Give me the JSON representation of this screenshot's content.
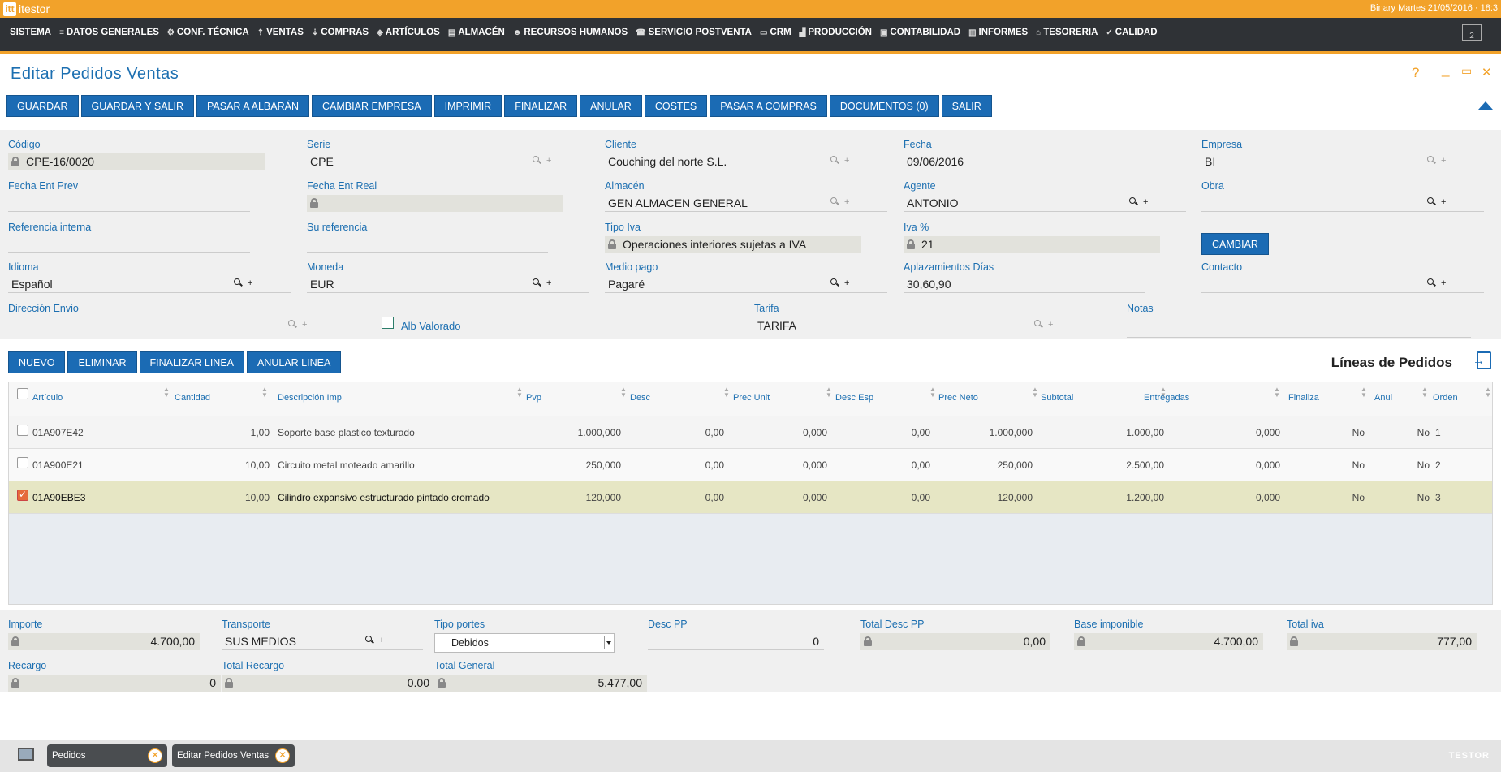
{
  "app": {
    "logo_letters": "itt",
    "name": "itestor",
    "status": "Binary  Martes 21/05/2016 · 18:3"
  },
  "menu": [
    {
      "label": "SISTEMA",
      "icon": ""
    },
    {
      "label": "DATOS GENERALES",
      "icon": "database-icon"
    },
    {
      "label": "CONF. TÉCNICA",
      "icon": "gear-icon"
    },
    {
      "label": "VENTAS",
      "icon": "upload-icon"
    },
    {
      "label": "COMPRAS",
      "icon": "download-icon"
    },
    {
      "label": "ARTÍCULOS",
      "icon": "cubes-icon"
    },
    {
      "label": "ALMACÉN",
      "icon": "warehouse-icon"
    },
    {
      "label": "RECURSOS HUMANOS",
      "icon": "users-icon"
    },
    {
      "label": "SERVICIO POSTVENTA",
      "icon": "service-icon"
    },
    {
      "label": "CRM",
      "icon": "briefcase-icon"
    },
    {
      "label": "PRODUCCIÓN",
      "icon": "factory-icon"
    },
    {
      "label": "CONTABILIDAD",
      "icon": "ledger-icon"
    },
    {
      "label": "INFORMES",
      "icon": "report-icon"
    },
    {
      "label": "TESORERIA",
      "icon": "bank-icon"
    },
    {
      "label": "CALIDAD",
      "icon": "thumbs-up-icon"
    }
  ],
  "menu_screen_label": "2",
  "page": {
    "title": "Editar  Pedidos  Ventas"
  },
  "window_controls": {
    "help": "?",
    "minimize": "_",
    "maximize": "▭",
    "close": "✕"
  },
  "toolbar": [
    "GUARDAR",
    "GUARDAR Y SALIR",
    "PASAR A ALBARÁN",
    "CAMBIAR EMPRESA",
    "IMPRIMIR",
    "FINALIZAR",
    "ANULAR",
    "COSTES",
    "PASAR A COMPRAS",
    "DOCUMENTOS (0)",
    "SALIR"
  ],
  "form": {
    "codigo": {
      "label": "Código",
      "value": "CPE-16/0020"
    },
    "serie": {
      "label": "Serie",
      "value": "CPE"
    },
    "cliente": {
      "label": "Cliente",
      "value": "Couching  del norte S.L."
    },
    "fecha": {
      "label": "Fecha",
      "value": "09/06/2016"
    },
    "empresa": {
      "label": "Empresa",
      "value": "BI"
    },
    "fecha_ent_prev": {
      "label": "Fecha Ent Prev",
      "value": ""
    },
    "fecha_ent_real": {
      "label": "Fecha Ent Real",
      "value": ""
    },
    "almacen": {
      "label": "Almacén",
      "value": "GEN ALMACEN GENERAL"
    },
    "agente": {
      "label": "Agente",
      "value": "ANTONIO"
    },
    "obra": {
      "label": "Obra",
      "value": ""
    },
    "referencia_interna": {
      "label": "Referencia interna",
      "value": ""
    },
    "su_referencia": {
      "label": "Su referencia",
      "value": ""
    },
    "tipo_iva": {
      "label": "Tipo Iva",
      "value": "Operaciones interiores sujetas a IVA"
    },
    "iva": {
      "label": "Iva %",
      "value": "21"
    },
    "cambiar": "CAMBIAR",
    "idioma": {
      "label": "Idioma",
      "value": "Español"
    },
    "moneda": {
      "label": "Moneda",
      "value": "EUR"
    },
    "medio_pago": {
      "label": "Medio pago",
      "value": "Pagaré"
    },
    "aplazamientos": {
      "label": "Aplazamientos Días",
      "value": "30,60,90"
    },
    "contacto": {
      "label": "Contacto",
      "value": ""
    },
    "direccion_envio": {
      "label": "Dirección Envio",
      "value": ""
    },
    "alb_valorado": {
      "label": "Alb Valorado",
      "checked": false
    },
    "tarifa": {
      "label": "Tarifa",
      "value": "TARIFA"
    },
    "notas": {
      "label": "Notas",
      "value": ""
    }
  },
  "line_buttons": [
    "NUEVO",
    "ELIMINAR",
    "FINALIZAR LINEA",
    "ANULAR LINEA"
  ],
  "lines_title": "Líneas de Pedidos",
  "table": {
    "columns": [
      "Artículo",
      "Cantidad",
      "Descripción Imp",
      "Pvp",
      "Desc",
      "Prec Unit",
      "Desc Esp",
      "Prec Neto",
      "Subtotal",
      "Entregadas",
      "Finaliza",
      "Anul",
      "Orden"
    ],
    "rows": [
      {
        "articulo": "01A907E42",
        "cantidad": "1,00",
        "descripcion": "Soporte base plastico texturado",
        "pvp": "1.000,000",
        "desc": "0,00",
        "prec_unit": "0,000",
        "desc_esp": "0,00",
        "prec_neto": "1.000,000",
        "subtotal": "1.000,00",
        "entregadas": "0,000",
        "finaliza": "No",
        "anul": "No",
        "orden": "1",
        "selected": false
      },
      {
        "articulo": "01A900E21",
        "cantidad": "10,00",
        "descripcion": "Circuito metal moteado amarillo",
        "pvp": "250,000",
        "desc": "0,00",
        "prec_unit": "0,000",
        "desc_esp": "0,00",
        "prec_neto": "250,000",
        "subtotal": "2.500,00",
        "entregadas": "0,000",
        "finaliza": "No",
        "anul": "No",
        "orden": "2",
        "selected": false
      },
      {
        "articulo": "01A90EBE3",
        "cantidad": "10,00",
        "descripcion": "Cilindro expansivo estructurado pintado cromado",
        "pvp": "120,000",
        "desc": "0,00",
        "prec_unit": "0,000",
        "desc_esp": "0,00",
        "prec_neto": "120,000",
        "subtotal": "1.200,00",
        "entregadas": "0,000",
        "finaliza": "No",
        "anul": "No",
        "orden": "3",
        "selected": true
      }
    ]
  },
  "totals": {
    "importe": {
      "label": "Importe",
      "value": "4.700,00"
    },
    "transporte": {
      "label": "Transporte",
      "value": "SUS MEDIOS"
    },
    "tipo_portes": {
      "label": "Tipo portes",
      "value": "Debidos"
    },
    "desc_pp": {
      "label": "Desc PP",
      "value": "0"
    },
    "total_desc_pp": {
      "label": "Total Desc PP",
      "value": "0,00"
    },
    "base_imponible": {
      "label": "Base imponible",
      "value": "4.700,00"
    },
    "total_iva": {
      "label": "Total iva",
      "value": "777,00"
    },
    "recargo": {
      "label": "Recargo",
      "value": "0"
    },
    "total_recargo": {
      "label": "Total Recargo",
      "value": "0.00"
    },
    "total_general": {
      "label": "Total General",
      "value": "5.477,00"
    }
  },
  "taskbar": {
    "tabs": [
      "Pedidos",
      "Editar Pedidos Ventas"
    ],
    "brand": "TESTOR"
  },
  "colors": {
    "accent_orange": "#f2a22a",
    "primary_blue": "#1b6bb4",
    "menubar": "#2f3236",
    "label_blue": "#1c6fb1"
  }
}
